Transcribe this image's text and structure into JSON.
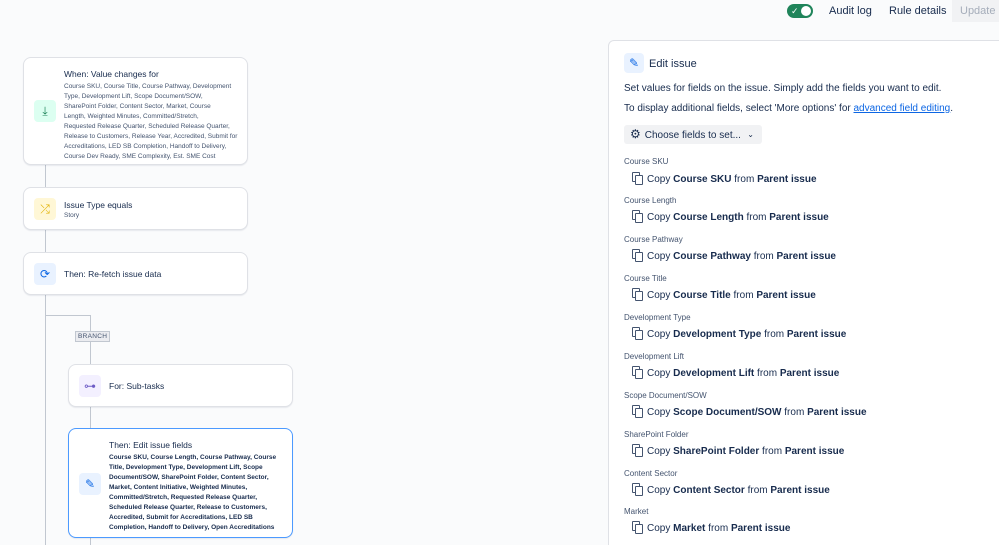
{
  "topbar": {
    "audit_log": "Audit log",
    "rule_details": "Rule details",
    "update": "Update"
  },
  "canvas": {
    "trigger": {
      "title": "When: Value changes for",
      "fields_lines": [
        "Course SKU, Course Title, Course Pathway, Development",
        "Type, Development Lift, Scope Document/SOW,",
        "SharePoint Folder, Content Sector, Market, Course",
        "Length, Weighted Minutes, Committed/Stretch,",
        "Requested Release Quarter, Scheduled Release Quarter,",
        "Release to Customers, Release Year, Accredited, Submit for",
        "Accreditations, LED SB Completion, Handoff to Delivery,",
        "Course Dev Ready, SME Complexity, Est. SME Cost"
      ]
    },
    "condition": {
      "title": "Issue Type equals",
      "value": "Story"
    },
    "refetch": {
      "title": "Then: Re-fetch issue data"
    },
    "branch_label": "BRANCH",
    "for_subtasks": {
      "title": "For: Sub-tasks"
    },
    "edit_fields": {
      "title": "Then: Edit issue fields",
      "fields_lines": [
        "Course SKU, Course Length, Course Pathway, Course",
        "Title, Development Type, Development Lift, Scope",
        "Document/SOW, SharePoint Folder, Content Sector,",
        "Market, Content Initiative, Weighted Minutes,",
        "Committed/Stretch, Requested Release Quarter,",
        "Scheduled Release Quarter, Release to Customers,",
        "Accredited, Submit for Accreditations, LED SB",
        "Completion, Handoff to Delivery, Open Accreditations"
      ]
    }
  },
  "panel": {
    "title": "Edit issue",
    "desc1": "Set values for fields on the issue. Simply add the fields you want to edit.",
    "desc2_prefix": "To display additional fields, select 'More options' for ",
    "desc2_link": "advanced field editing",
    "desc2_suffix": ".",
    "choose_fields": "Choose fields to set...",
    "copy_word": "Copy",
    "from_word": "from",
    "source": "Parent issue",
    "fields": [
      {
        "label": "Course SKU",
        "name": "Course SKU"
      },
      {
        "label": "Course Length",
        "name": "Course Length"
      },
      {
        "label": "Course Pathway",
        "name": "Course Pathway"
      },
      {
        "label": "Course Title",
        "name": "Course Title"
      },
      {
        "label": "Development Type",
        "name": "Development Type"
      },
      {
        "label": "Development Lift",
        "name": "Development Lift"
      },
      {
        "label": "Scope Document/SOW",
        "name": "Scope Document/SOW"
      },
      {
        "label": "SharePoint Folder",
        "name": "SharePoint Folder"
      },
      {
        "label": "Content Sector",
        "name": "Content Sector"
      },
      {
        "label": "Market",
        "name": "Market"
      }
    ]
  },
  "colors": {
    "accent": "#0c66e4",
    "toggle_on": "#1f845a",
    "selected_border": "#4c9aff"
  },
  "icons": {
    "trigger": "download-arrow-icon",
    "condition": "shuffle-icon",
    "refetch": "refresh-icon",
    "branch": "hierarchy-icon",
    "edit": "pencil-icon",
    "copy": "copy-icon",
    "gear": "gear-icon"
  }
}
